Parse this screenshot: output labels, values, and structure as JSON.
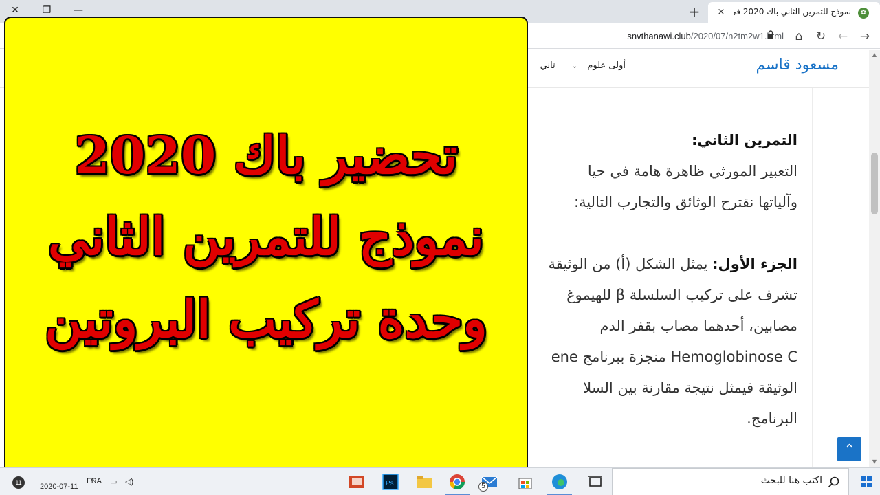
{
  "browser": {
    "tab_title": "نموذج للتمرين الثاني باك 2020 في",
    "tab_close_icon": "×",
    "new_tab_icon": "+",
    "window_close_icon": "✕",
    "window_restore_icon": "❐",
    "window_minimize_icon": "—",
    "url_host": "snvthanawi.club",
    "url_path": "/2020/07/n2tm2w1.html",
    "home_icon": "⌂",
    "reload_icon": "↻",
    "back_icon": "←",
    "forward_icon": "→"
  },
  "site": {
    "logo": "مسعود قاسم",
    "nav": [
      {
        "label": "أولى علوم"
      },
      {
        "label": "ثاني"
      }
    ],
    "nav_caret": "⌄",
    "scroll_top_icon": "⌃"
  },
  "article": {
    "heading": "التمرين الثاني:",
    "lines": [
      "التعبير المورثي ظاهرة هامة في حيا",
      "وآلياتها نقترح الوثائق والتجارب التالية:"
    ],
    "part1_label": "الجزء الأول:",
    "part1_first": "يمثل الشكل (أ) من الوثيقة",
    "part1_lines": [
      "تشرف على تركيب السلسلة β للهيموغ",
      "مصابين، أحدهما مصاب بقفر الدم",
      "Hemoglobinose C منجزة ببرنامج ene",
      "الوثيقة فيمثل نتيجة مقارنة بين السلا",
      "البرنامج."
    ]
  },
  "overlay": {
    "line1": "تحضير باك 2020",
    "line2": "نموذج للتمرين الثاني",
    "line3": "وحدة تركيب البروتين"
  },
  "taskbar": {
    "search_placeholder": "اكتب هنا للبحث",
    "date": "2020-07-11",
    "language": "FRA",
    "mail_badge": "5",
    "notification_count": "11"
  },
  "colors": {
    "overlay_bg": "#ffff00",
    "overlay_text": "#e00000",
    "brand_blue": "#1a73c7"
  }
}
